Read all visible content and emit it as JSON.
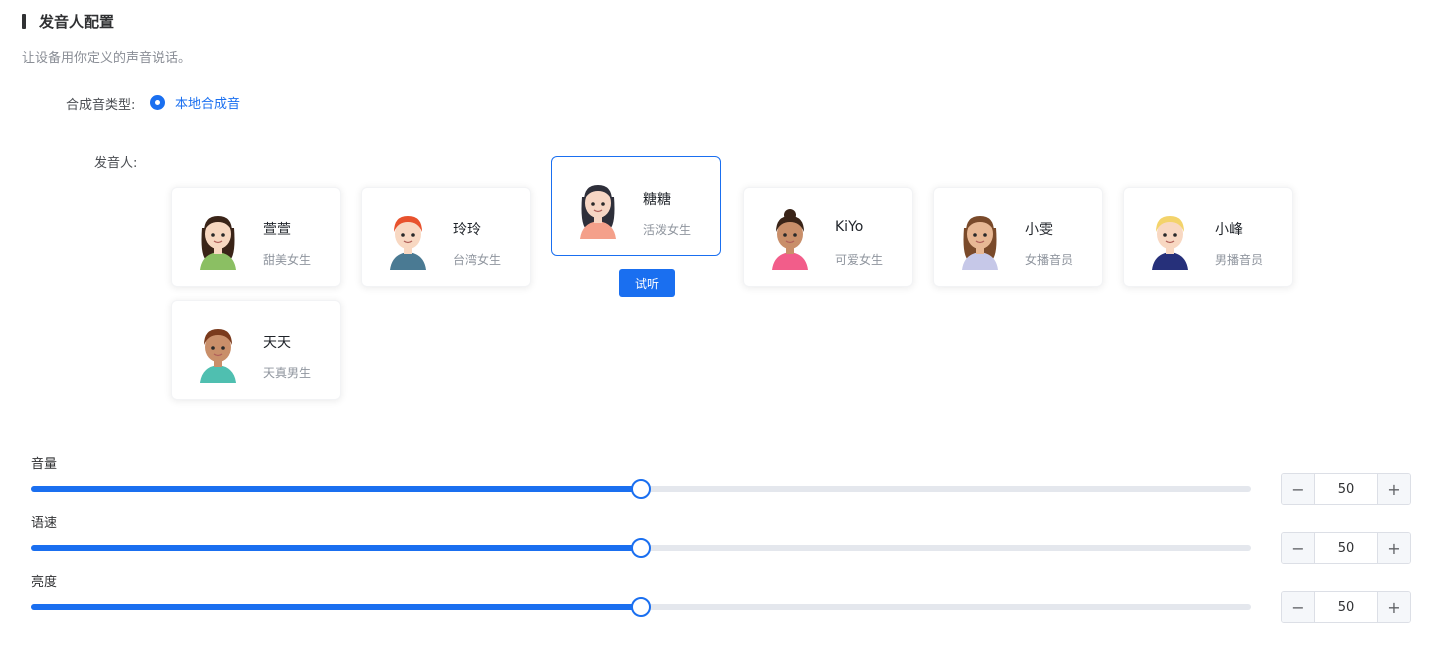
{
  "section": {
    "title": "发音人配置",
    "description": "让设备用你定义的声音说话。"
  },
  "synthesis": {
    "label": "合成音类型:",
    "option": "本地合成音",
    "selected": true
  },
  "speakers": {
    "label": "发音人:",
    "listen_button": "试听",
    "selected_index": 2,
    "items": [
      {
        "name": "萱萱",
        "desc": "甜美女生",
        "hair": "#3a2418",
        "skin": "#f7d7c0",
        "shirt": "#8bbf63"
      },
      {
        "name": "玲玲",
        "desc": "台湾女生",
        "hair": "#e8522d",
        "skin": "#f8d8c2",
        "shirt": "#4a7a93"
      },
      {
        "name": "糖糖",
        "desc": "活泼女生",
        "hair": "#2e2f3a",
        "skin": "#f6d6c4",
        "shirt": "#f4a08a"
      },
      {
        "name": "KiYo",
        "desc": "可爱女生",
        "hair": "#3a2418",
        "skin": "#c98f6a",
        "shirt": "#f25d8a"
      },
      {
        "name": "小雯",
        "desc": "女播音员",
        "hair": "#7a4a2a",
        "skin": "#e8b894",
        "shirt": "#c6c8e8"
      },
      {
        "name": "小峰",
        "desc": "男播音员",
        "hair": "#f3d36b",
        "skin": "#f8d8c2",
        "shirt": "#26307a"
      },
      {
        "name": "天天",
        "desc": "天真男生",
        "hair": "#7a3a1c",
        "skin": "#c98f6a",
        "shirt": "#4fbfb0"
      }
    ]
  },
  "sliders": [
    {
      "label": "音量",
      "value": "50",
      "percent": 50
    },
    {
      "label": "语速",
      "value": "50",
      "percent": 50
    },
    {
      "label": "亮度",
      "value": "50",
      "percent": 50
    }
  ],
  "stepper": {
    "minus": "−",
    "plus": "+"
  }
}
